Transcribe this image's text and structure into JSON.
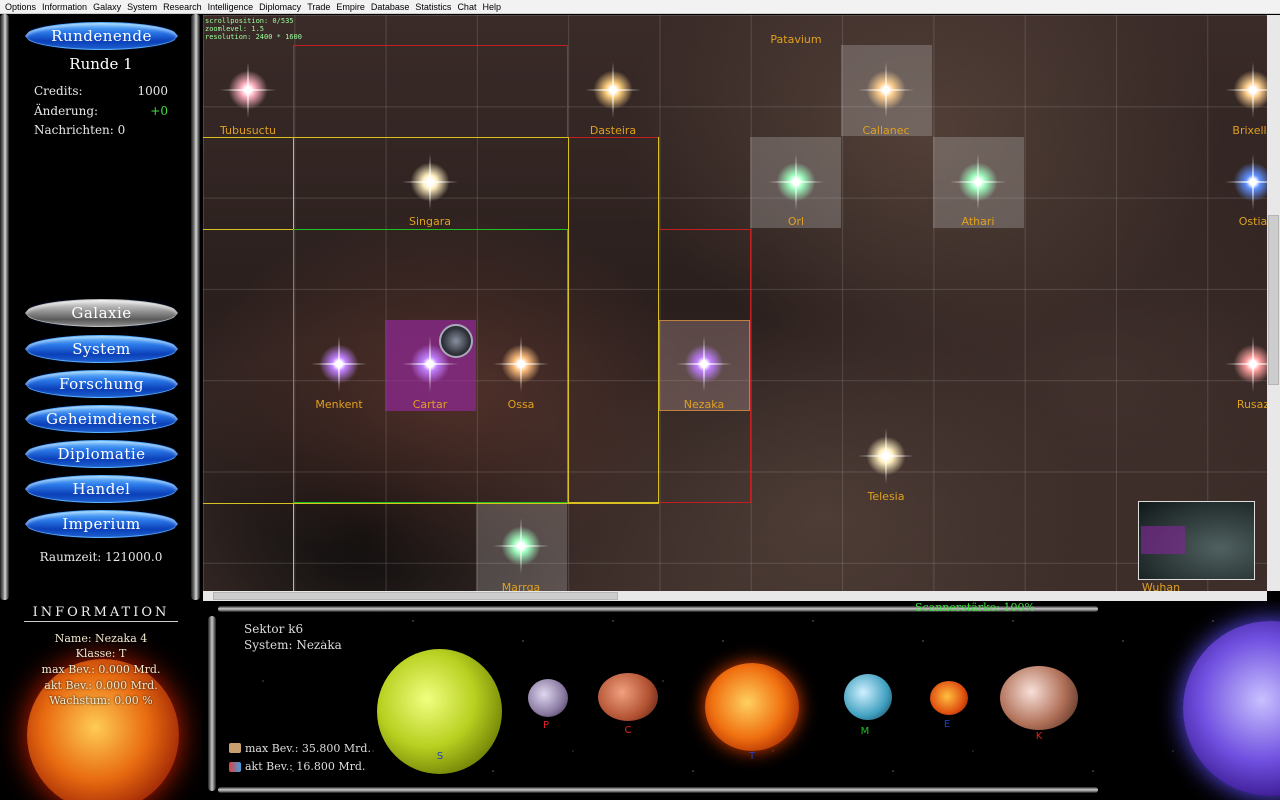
{
  "menu": [
    "Options",
    "Information",
    "Galaxy",
    "System",
    "Research",
    "Intelligence",
    "Diplomacy",
    "Trade",
    "Empire",
    "Database",
    "Statistics",
    "Chat",
    "Help"
  ],
  "left": {
    "end_turn": "Rundenende",
    "round": "Runde 1",
    "credits_label": "Credits:",
    "credits_value": "1000",
    "change_label": "Änderung:",
    "change_value": "+0",
    "messages": "Nachrichten: 0",
    "nav": [
      "Galaxie",
      "System",
      "Forschung",
      "Geheimdienst",
      "Diplomatie",
      "Handel",
      "Imperium"
    ],
    "spacetime": "Raumzeit: 121000.0"
  },
  "debug": {
    "line1": "scrollposition: 0/535",
    "line2": "zoomlevel: 1.5",
    "line3": "resolution: 2400 * 1600"
  },
  "stars": [
    {
      "name": "Tubusuctu",
      "color": "#ffb0c0"
    },
    {
      "name": "Dasteira",
      "color": "#ffd080"
    },
    {
      "name": "Patavium",
      "color": ""
    },
    {
      "name": "Callanec",
      "color": "#ffd090"
    },
    {
      "name": "Brixellu",
      "color": "#ffd090"
    },
    {
      "name": "Singara",
      "color": "#fff0c0"
    },
    {
      "name": "Orl",
      "color": "#c0ffd0"
    },
    {
      "name": "Athari",
      "color": "#c0ffd0"
    },
    {
      "name": "Ostia",
      "color": "#80b0ff"
    },
    {
      "name": "Menkent",
      "color": "#c080ff"
    },
    {
      "name": "Cartar",
      "color": "#c080ff"
    },
    {
      "name": "Ossa",
      "color": "#ffd090"
    },
    {
      "name": "Nezaka",
      "color": "#c080ff"
    },
    {
      "name": "Rusaz",
      "color": "#ffb0b0"
    },
    {
      "name": "Telesia",
      "color": "#fff0c0"
    },
    {
      "name": "Marrga",
      "color": "#c0ffd0"
    },
    {
      "name": "Wuhan",
      "color": ""
    }
  ],
  "info": {
    "header": "INFORMATION",
    "name": "Name: Nezaka 4",
    "class": "Klasse: T",
    "max_pop": "max Bev.: 0.000 Mrd.",
    "cur_pop": "akt Bev.: 0.000 Mrd.",
    "growth": "Wachstum: 0.00 %"
  },
  "system": {
    "sector": "Sektor k6",
    "system": "System: Nezaka",
    "scanner": "Scannerstärke: 100%",
    "max_pop": "max Bev.: 35.800 Mrd.",
    "cur_pop": "akt Bev.: 16.800 Mrd.",
    "planets": [
      {
        "cls": "S",
        "color": "#2040c0"
      },
      {
        "cls": "P",
        "color": "#e02020"
      },
      {
        "cls": "C",
        "color": "#e02020"
      },
      {
        "cls": "T",
        "color": "#2040c0"
      },
      {
        "cls": "M",
        "color": "#20c020"
      },
      {
        "cls": "E",
        "color": "#2040c0"
      },
      {
        "cls": "K",
        "color": "#e02020"
      }
    ]
  }
}
